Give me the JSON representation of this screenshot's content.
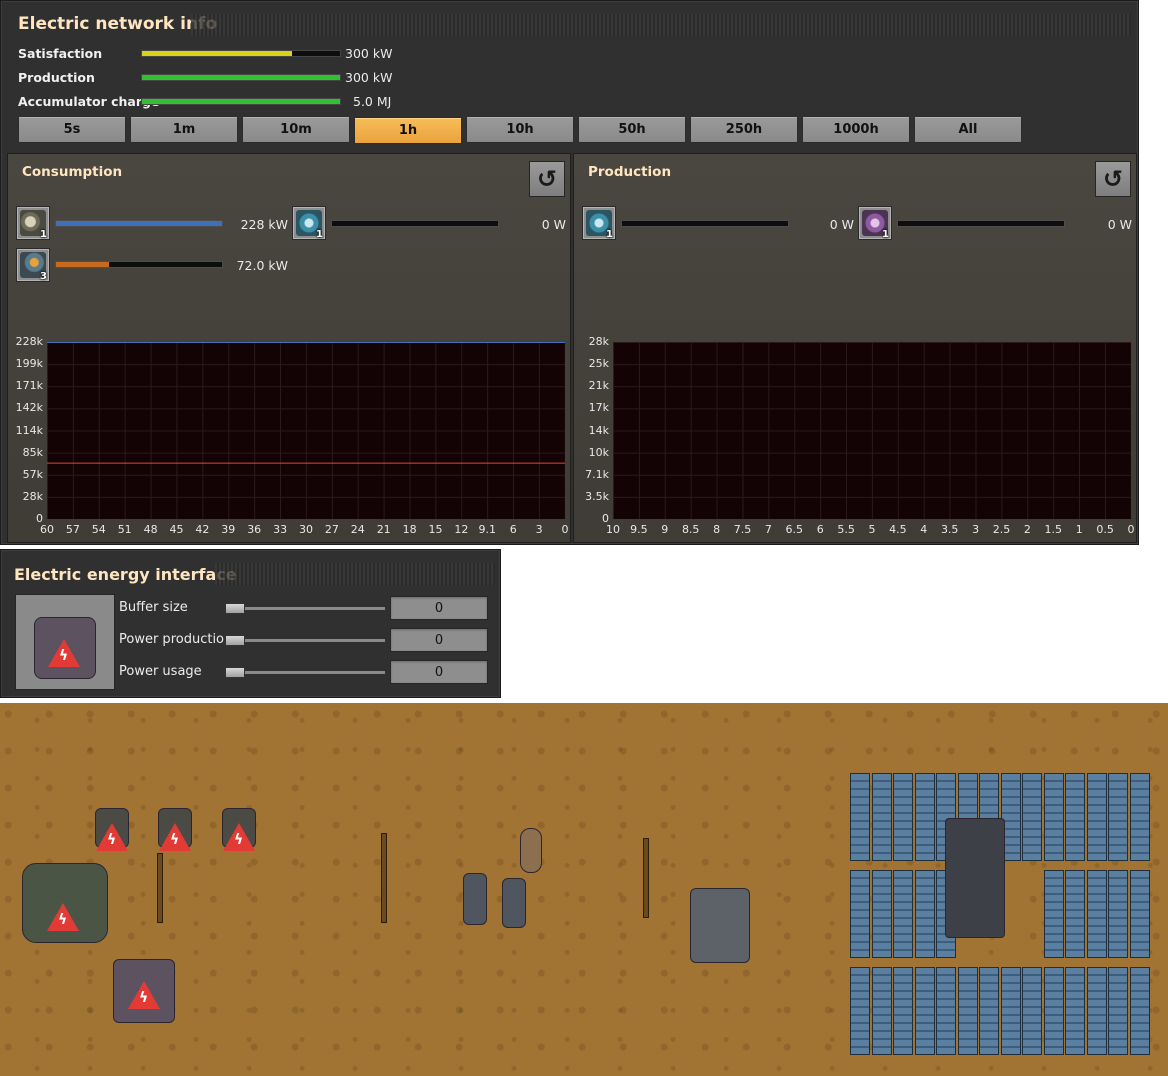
{
  "network": {
    "title": "Electric network info",
    "stats": [
      {
        "label": "Satisfaction",
        "value": "300 kW",
        "fill": 0.76,
        "color": "#d8d31a"
      },
      {
        "label": "Production",
        "value": "300 kW",
        "fill": 1.0,
        "color": "#2fc12f"
      },
      {
        "label": "Accumulator charge",
        "value": "5.0 MJ",
        "fill": 1.0,
        "color": "#2fc12f"
      }
    ],
    "tabs": [
      "5s",
      "1m",
      "10m",
      "1h",
      "10h",
      "50h",
      "250h",
      "1000h",
      "All"
    ],
    "active_tab": "1h"
  },
  "consumption": {
    "title": "Consumption",
    "entries": [
      {
        "icon": "radar-icon",
        "count": "1",
        "value": "228 kW",
        "fill": 1.0,
        "color": "#3e6fb8"
      },
      {
        "icon": "electric-energy-interface-icon",
        "count": "1",
        "value": "0 W",
        "fill": 0.0,
        "color": "#888888"
      },
      {
        "icon": "laser-turret-icon",
        "count": "3",
        "value": "72.0 kW",
        "fill": 0.32,
        "color": "#c56a1e"
      }
    ],
    "y_ticks": [
      "228k",
      "199k",
      "171k",
      "142k",
      "114k",
      "85k",
      "57k",
      "28k",
      "0"
    ],
    "x_ticks": [
      "60",
      "57",
      "54",
      "51",
      "48",
      "45",
      "42",
      "39",
      "36",
      "33",
      "30",
      "27",
      "24",
      "21",
      "18",
      "15",
      "12",
      "9.1",
      "6",
      "3",
      "0"
    ]
  },
  "production": {
    "title": "Production",
    "entries": [
      {
        "icon": "electric-energy-interface-icon",
        "count": "1",
        "value": "0 W",
        "fill": 0.0,
        "color": "#888888"
      },
      {
        "icon": "electric-energy-interface-icon",
        "count": "1",
        "value": "0 W",
        "fill": 0.0,
        "color": "#888888"
      }
    ],
    "y_ticks": [
      "28k",
      "25k",
      "21k",
      "17k",
      "14k",
      "10k",
      "7.1k",
      "3.5k",
      "0"
    ],
    "x_ticks": [
      "10",
      "9.5",
      "9",
      "8.5",
      "8",
      "7.5",
      "7",
      "6.5",
      "6",
      "5.5",
      "5",
      "4.5",
      "4",
      "3.5",
      "3",
      "2.5",
      "2",
      "1.5",
      "1",
      "0.5",
      "0"
    ]
  },
  "chart_data": [
    {
      "type": "line",
      "title": "Consumption",
      "x": [
        60,
        0
      ],
      "ylim": [
        0,
        228
      ],
      "series": [
        {
          "values": [
            228,
            228
          ],
          "color": "#3e6fb8"
        },
        {
          "values": [
            72,
            72
          ],
          "color": "#e04a3a"
        }
      ]
    },
    {
      "type": "line",
      "title": "Production",
      "x": [
        10,
        0
      ],
      "ylim": [
        0,
        28
      ],
      "series": []
    }
  ],
  "interface": {
    "title": "Electric energy interface",
    "rows": [
      {
        "label": "Buffer size",
        "value": "0"
      },
      {
        "label": "Power production",
        "value": "0"
      },
      {
        "label": "Power usage",
        "value": "0"
      }
    ]
  }
}
